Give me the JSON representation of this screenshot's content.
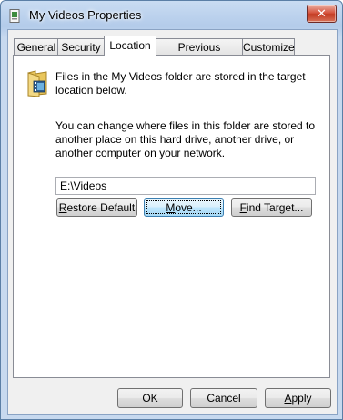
{
  "window": {
    "title": "My Videos Properties",
    "close_glyph": "✕"
  },
  "tabs": [
    {
      "label": "General",
      "active": false
    },
    {
      "label": "Security",
      "active": false
    },
    {
      "label": "Location",
      "active": true
    },
    {
      "label": "Previous Versions",
      "active": false
    },
    {
      "label": "Customize",
      "active": false
    }
  ],
  "location": {
    "info_text": "Files in the My Videos folder are stored in the target location below.",
    "change_text": "You can change where files in this folder are stored to another place on this hard drive, another drive, or another computer on your network.",
    "path_value": "E:\\Videos",
    "restore_default": {
      "mnemonic": "R",
      "rest": "estore Default"
    },
    "move": {
      "mnemonic": "M",
      "rest": "ove..."
    },
    "find_target": {
      "mnemonic": "F",
      "rest": "ind Target..."
    }
  },
  "footer": {
    "ok_label": "OK",
    "cancel_label": "Cancel",
    "apply": {
      "mnemonic": "A",
      "rest": "pply"
    }
  },
  "icons": {
    "title_icon": "video-properties-icon",
    "folder_icon": "video-folder-icon",
    "close_icon": "close-icon"
  }
}
